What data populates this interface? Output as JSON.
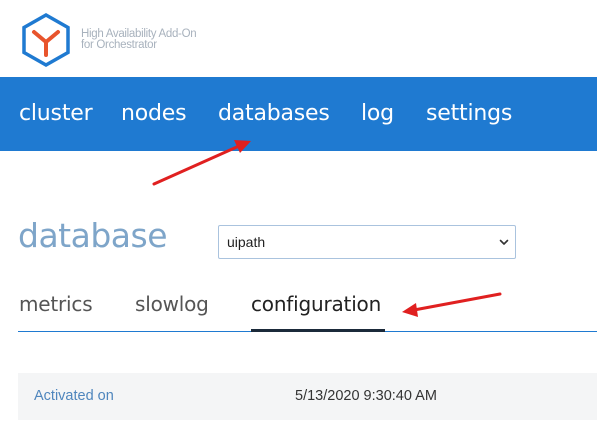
{
  "brand": {
    "line1": "High Availability Add-On",
    "line2": "for Orchestrator",
    "logo_icon": "hexagon-y-logo-icon",
    "colors": {
      "hex": "#1f7ad1",
      "mark": "#e8542c"
    }
  },
  "nav": {
    "items": [
      {
        "label": "cluster"
      },
      {
        "label": "nodes"
      },
      {
        "label": "databases"
      },
      {
        "label": "log"
      },
      {
        "label": "settings"
      }
    ],
    "background": "#1f7ad1"
  },
  "page": {
    "title": "database",
    "select": {
      "value": "uipath"
    }
  },
  "tabs": {
    "items": [
      {
        "label": "metrics"
      },
      {
        "label": "slowlog"
      },
      {
        "label": "configuration",
        "active": true
      }
    ]
  },
  "config": {
    "rows": [
      {
        "key": "Activated on",
        "value": "5/13/2020 9:30:40 AM"
      }
    ]
  },
  "annotations": {
    "arrow_color": "#e02020"
  }
}
